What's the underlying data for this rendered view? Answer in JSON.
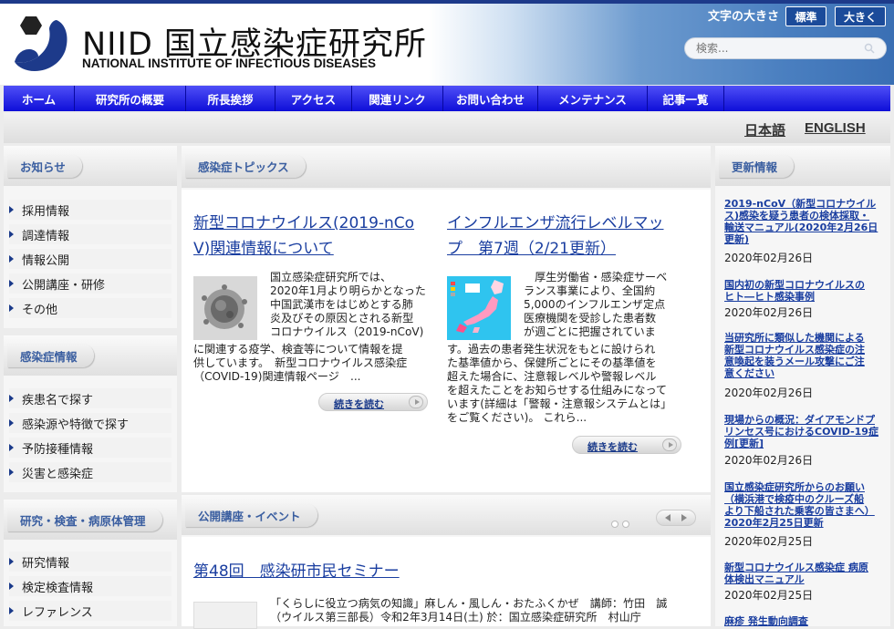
{
  "header": {
    "logo_name": "NIID 国立感染症研究所",
    "logo_sub": "NATIONAL INSTITUTE OF INFECTIOUS DISEASES",
    "fontsize_label": "文字の大きさ",
    "fontsize_standard": "標準",
    "fontsize_large": "大きく",
    "search_placeholder": "検索..."
  },
  "nav": [
    {
      "label": "ホーム"
    },
    {
      "label": "研究所の概要"
    },
    {
      "label": "所長挨拶"
    },
    {
      "label": "アクセス"
    },
    {
      "label": "関連リンク"
    },
    {
      "label": "お問い合わせ"
    },
    {
      "label": "メンテナンス"
    },
    {
      "label": "記事一覧"
    }
  ],
  "lang": {
    "ja": "日本語",
    "en": "ENGLISH"
  },
  "sidebar": {
    "notices": {
      "title": "お知らせ",
      "items": [
        "採用情報",
        "調達情報",
        "情報公開",
        "公開講座・研修",
        "その他"
      ]
    },
    "infection": {
      "title": "感染症情報",
      "items": [
        "疾患名で探す",
        "感染源や特徴で探す",
        "予防接種情報",
        "災害と感染症"
      ]
    },
    "research": {
      "title": "研究・検査・病原体管理",
      "items": [
        "研究情報",
        "検定検査情報",
        "レファレンス"
      ]
    }
  },
  "topics": {
    "title": "感染症トピックス",
    "articles": [
      {
        "headline_1": "新型コロナウイルス(2019-nCo",
        "headline_2": "V)関連情報について",
        "text": [
          "国立感染症研究所では、",
          "2020年1月より明らかとなった",
          "中国武漢市をはじめとする肺",
          "炎及びその原因とされる新型",
          "コロナウイルス（2019-nCoV)",
          "に関連する疫学、検査等について情報を提",
          "供しています。　新型コロナウイルス感染症",
          "（COVID-19)関連情報ページ　..."
        ],
        "readmore": "続きを読む"
      },
      {
        "headline_1": "インフルエンザ流行レベルマッ",
        "headline_2": "プ　第7週（2/21更新）",
        "text": [
          "　厚生労働省・感染症サーベ",
          "ランス事業により、全国約",
          "5,000のインフルエンザ定点",
          "医療機関を受診した患者数",
          "が週ごとに把握されていま",
          "す。過去の患者発生状況をもとに設けられ",
          "た基準値から、保健所ごとにその基準値を",
          "超えた場合に、注意報レベルや警報レベル",
          "を超えたことをお知らせする仕組みになって",
          "います(詳細は「警報・注意報システムとは」",
          "をご覧ください)。  これら..."
        ],
        "readmore": "続きを読む"
      }
    ]
  },
  "events": {
    "title": "公開講座・イベント",
    "headline": "第48回　感染研市民セミナー",
    "text": [
      "「くらしに役立つ病気の知識」麻しん・風しん・おたふくかぜ　講師：竹田　誠",
      "（ウイルス第三部長）令和2年3月14日(土) 於：国立感染症研究所　村山庁"
    ]
  },
  "updates": {
    "title": "更新情報",
    "items": [
      {
        "lines": [
          "2019-nCoV（新型コロナウイル",
          "ス)感染を疑う患者の検体採取・",
          "輸送マニュアル(2020年2月26日",
          "更新)"
        ],
        "date": "2020年02月26日"
      },
      {
        "lines": [
          "国内初の新型コロナウイルスの",
          "ヒト―ヒト感染事例"
        ],
        "date": "2020年02月26日"
      },
      {
        "lines": [
          "当研究所に類似した機関による",
          "新型コロナウイルス感染症の注",
          "意喚起を装うメール攻撃にご注",
          "意ください"
        ],
        "date": "2020年02月26日"
      },
      {
        "lines": [
          "現場からの概況：ダイアモンドプ",
          "リンセス号におけるCOVID-19症",
          "例[更新]"
        ],
        "date": "2020年02月26日"
      },
      {
        "lines": [
          "国立感染症研究所からのお願い",
          "（横浜港で検疫中のクルーズ船",
          "より下船された乗客の皆さまへ）",
          "2020年2月25日更新"
        ],
        "date": "2020年02月25日"
      },
      {
        "lines": [
          "新型コロナウイルス感染症 病原",
          "体検出マニュアル"
        ],
        "date": "2020年02月25日"
      },
      {
        "lines": [
          "麻疹 発生動向調査"
        ],
        "date": ""
      }
    ]
  },
  "colors": {
    "nav": "#1a1ae0",
    "link": "#1a3ea0",
    "brand": "#1d3a8a"
  }
}
